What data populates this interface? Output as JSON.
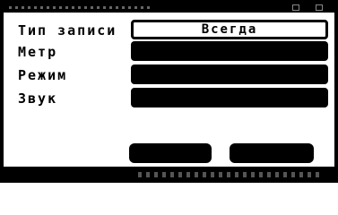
{
  "dialog": {
    "fields": [
      {
        "label": "Тип записи",
        "value": "Всегда",
        "selected": true
      },
      {
        "label": "Метр",
        "value": ""
      },
      {
        "label": "Режим",
        "value": ""
      },
      {
        "label": "Звук",
        "value": ""
      }
    ],
    "buttons": {
      "ok_label": "",
      "cancel_label": ""
    }
  },
  "colors": {
    "background": "#ffffff",
    "foreground": "#000000"
  }
}
